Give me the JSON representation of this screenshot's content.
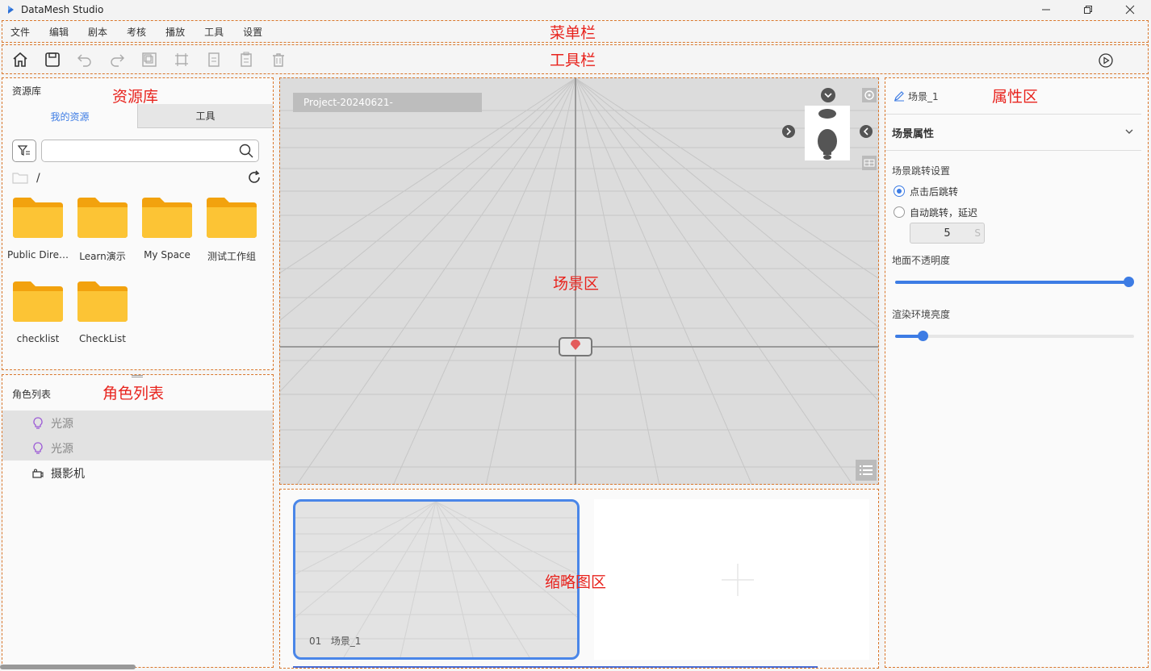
{
  "window": {
    "title": "DataMesh Studio"
  },
  "menu": {
    "items": [
      "文件",
      "编辑",
      "剧本",
      "考核",
      "播放",
      "工具",
      "设置"
    ]
  },
  "annotations": {
    "menubar": "菜单栏",
    "toolbar": "工具栏",
    "resources": "资源库",
    "roles": "角色列表",
    "scene": "场景区",
    "thumbs": "缩略图区",
    "props": "属性区"
  },
  "resources": {
    "header": "资源库",
    "tabs": [
      "我的资源",
      "工具"
    ],
    "search_placeholder": "",
    "path": "/",
    "folders": [
      "Public Dire…",
      "Learn演示",
      "My Space",
      "测试工作组",
      "checklist",
      "CheckList"
    ]
  },
  "roles": {
    "header": "角色列表",
    "items": [
      {
        "label": "光源",
        "icon": "bulb-icon",
        "selected": true
      },
      {
        "label": "光源",
        "icon": "bulb-icon",
        "selected": true
      },
      {
        "label": "摄影机",
        "icon": "camera-icon",
        "selected": false
      }
    ]
  },
  "scene": {
    "project_tag": "Project-20240621-"
  },
  "thumbs": {
    "items": [
      {
        "index": "01",
        "name": "场景_1"
      }
    ]
  },
  "props": {
    "title": "场景_1",
    "section": "场景属性",
    "jump_label": "场景跳转设置",
    "radio_click": "点击后跳转",
    "radio_auto": "自动跳转，延迟",
    "delay_value": "5",
    "delay_unit": "S",
    "ground_label": "地面不透明度",
    "ground_value": 1.0,
    "env_label": "渲染环境亮度",
    "env_value": 0.1
  },
  "colors": {
    "accent": "#3d7ce4",
    "annotation": "#e8231d",
    "dashed_border": "#d9772c",
    "folder": "#f7b21a"
  }
}
